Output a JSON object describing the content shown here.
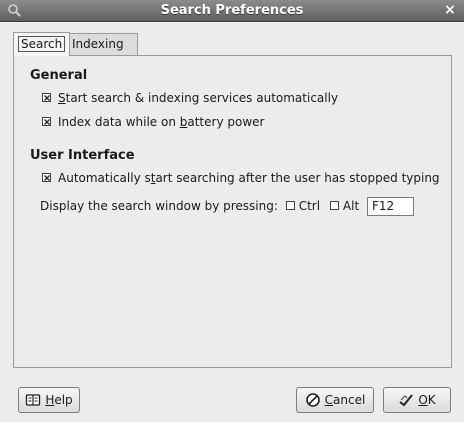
{
  "window": {
    "title": "Search Preferences",
    "close_glyph": "×"
  },
  "tabs": [
    {
      "label": "Search",
      "active": true
    },
    {
      "label": "Indexing",
      "active": false
    }
  ],
  "general": {
    "title": "General",
    "option1": {
      "pre": "",
      "mnemonic": "S",
      "post": "tart search & indexing services automatically",
      "checked": true
    },
    "option2": {
      "pre": "Index data while on ",
      "mnemonic": "b",
      "post": "attery power",
      "checked": true
    }
  },
  "user_interface": {
    "title": "User Interface",
    "option1": {
      "pre": "Automatically s",
      "mnemonic": "t",
      "post": "art searching after the user has stopped typing",
      "checked": true
    },
    "shortcut_label": "Display the search window by pressing:",
    "ctrl_label": "Ctrl",
    "ctrl_checked": false,
    "alt_label": "Alt",
    "alt_checked": false,
    "key_value": "F12"
  },
  "buttons": {
    "help": {
      "mnemonic": "H",
      "rest": "elp",
      "icon": "help-icon"
    },
    "cancel": {
      "mnemonic": "C",
      "rest": "ancel",
      "icon": "cancel-icon"
    },
    "ok": {
      "mnemonic": "O",
      "rest": "K",
      "icon": "ok-icon"
    }
  }
}
